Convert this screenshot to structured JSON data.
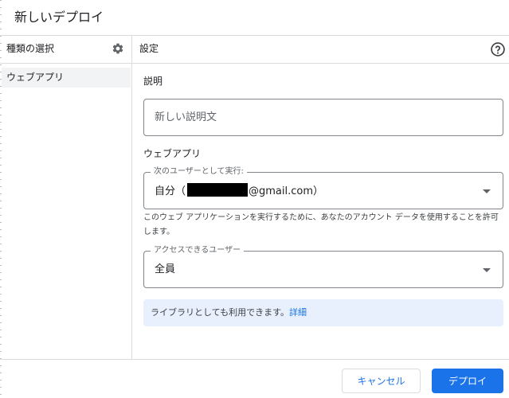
{
  "dialog": {
    "title": "新しいデプロイ"
  },
  "left_panel": {
    "header": "種類の選択",
    "settings_icon": "gear-icon",
    "items": [
      {
        "label": "ウェブアプリ",
        "selected": true
      }
    ]
  },
  "right_panel": {
    "header": "設定",
    "help_icon": "help-circle-icon",
    "description": {
      "section_label": "説明",
      "placeholder": "新しい説明文",
      "value": ""
    },
    "web_app": {
      "section_label": "ウェブアプリ",
      "execute_as": {
        "label": "次のユーザーとして実行:",
        "value_prefix": "自分（",
        "value_suffix": "@gmail.com）"
      },
      "execute_help": "このウェブ アプリケーションを実行するために、あなたのアカウント データを使用することを許可します。",
      "access": {
        "label": "アクセスできるユーザー",
        "value": "全員"
      }
    },
    "library_notice": {
      "text": "ライブラリとしても利用できます。",
      "link": "詳細"
    }
  },
  "footer": {
    "cancel_label": "キャンセル",
    "deploy_label": "デプロイ"
  },
  "colors": {
    "primary": "#1a73e8",
    "info_background": "#e8f0fe",
    "selected_item_background": "#f1f3f4",
    "border": "#dadce0"
  }
}
